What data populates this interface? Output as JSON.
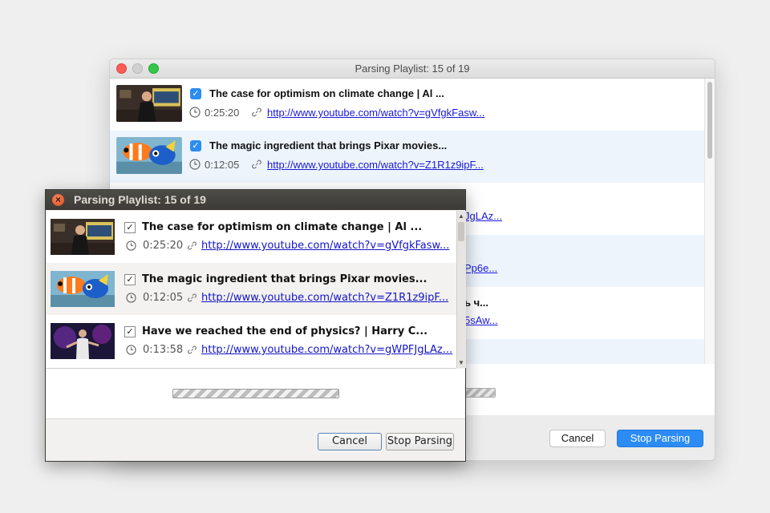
{
  "mac_window": {
    "title": "Parsing Playlist: 15 of 19",
    "items": [
      {
        "title": "The case for optimism on climate change | Al ...",
        "duration": "0:25:20",
        "url": "http://www.youtube.com/watch?v=gVfgkFasw...",
        "checked": true,
        "thumb_icon": "speaker-stage-thumbnail"
      },
      {
        "title": "The magic ingredient that brings Pixar movies...",
        "duration": "0:12:05",
        "url": "http://www.youtube.com/watch?v=Z1R1z9ipF...",
        "checked": true,
        "thumb_icon": "fish-animation-thumbnail"
      }
    ],
    "partial_fragments": [
      "JgLAz...",
      "Pp6e...",
      "ь ч...",
      "5sAw..."
    ],
    "cancel_label": "Cancel",
    "stop_label": "Stop Parsing",
    "colors": {
      "accent": "#2c8cf4",
      "row_alt": "#eef4fc"
    }
  },
  "linux_window": {
    "title": "Parsing Playlist: 15 of 19",
    "close_glyph": "×",
    "items": [
      {
        "title": "The case for optimism on climate change | Al ...",
        "duration": "0:25:20",
        "url": "http://www.youtube.com/watch?v=gVfgkFasw...",
        "checked": true,
        "thumb_icon": "speaker-stage-thumbnail"
      },
      {
        "title": "The magic ingredient that brings Pixar movies...",
        "duration": "0:12:05",
        "url": "http://www.youtube.com/watch?v=Z1R1z9ipF...",
        "checked": true,
        "thumb_icon": "fish-animation-thumbnail"
      },
      {
        "title": "Have we reached the end of physics? | Harry C...",
        "duration": "0:13:58",
        "url": "http://www.youtube.com/watch?v=gWPFJgLAz...",
        "checked": true,
        "thumb_icon": "speaker-purple-stage-thumbnail"
      }
    ],
    "cancel_label": "Cancel",
    "stop_label": "Stop Parsing",
    "colors": {
      "titlebar": "#3c3b37",
      "close": "#df4b17"
    }
  }
}
